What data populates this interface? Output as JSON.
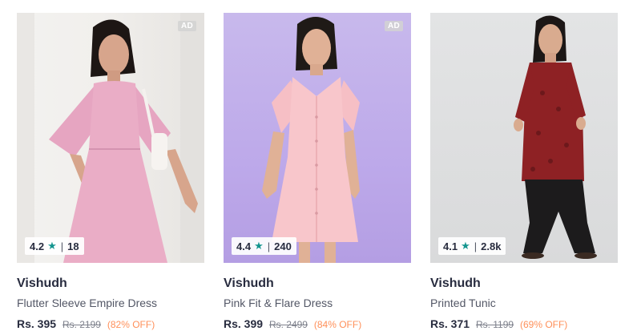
{
  "products": [
    {
      "ad": "AD",
      "rating": "4.2",
      "reviews": "18",
      "brand": "Vishudh",
      "name": "Flutter Sleeve Empire Dress",
      "price": "Rs. 395",
      "mrp": "Rs. 2199",
      "discount": "(82% OFF)",
      "image": "pink-flutter-sleeve-dress-photo"
    },
    {
      "ad": "AD",
      "rating": "4.4",
      "reviews": "240",
      "brand": "Vishudh",
      "name": "Pink Fit & Flare Dress",
      "price": "Rs. 399",
      "mrp": "Rs. 2499",
      "discount": "(84% OFF)",
      "image": "pink-fit-flare-dress-photo"
    },
    {
      "rating": "4.1",
      "reviews": "2.8k",
      "brand": "Vishudh",
      "name": "Printed Tunic",
      "price": "Rs. 371",
      "mrp": "Rs. 1199",
      "discount": "(69% OFF)",
      "image": "maroon-printed-tunic-photo"
    }
  ],
  "colors": {
    "star": "#14958f",
    "discount": "#ff905a",
    "brand_text": "#282c3f",
    "secondary_text": "#535766"
  }
}
